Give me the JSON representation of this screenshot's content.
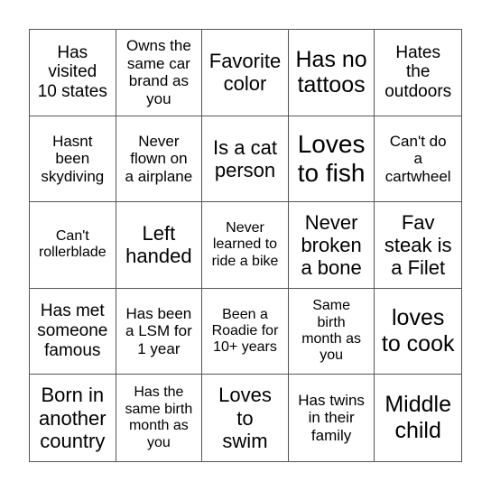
{
  "card": {
    "rows": [
      [
        {
          "text": "Has visited 10 states",
          "lines": [
            "Has",
            "visited",
            "10 states"
          ],
          "size": "m"
        },
        {
          "text": "Owns the same car brand as you",
          "lines": [
            "Owns the",
            "same car",
            "brand as",
            "you"
          ],
          "size": "s"
        },
        {
          "text": "Favorite color",
          "lines": [
            "Favorite",
            "color"
          ],
          "size": "l"
        },
        {
          "text": "Has no tattoos",
          "lines": [
            "Has no",
            "tattoos"
          ],
          "size": "xl"
        },
        {
          "text": "Hates the outdoors",
          "lines": [
            "Hates",
            "the",
            "outdoors"
          ],
          "size": "m"
        }
      ],
      [
        {
          "text": "Hasnt been skydiving",
          "lines": [
            "Hasnt",
            "been",
            "skydiving"
          ],
          "size": "s"
        },
        {
          "text": "Never flown on a airplane",
          "lines": [
            "Never",
            "flown on",
            "a airplane"
          ],
          "size": "s"
        },
        {
          "text": "Is a cat person",
          "lines": [
            "Is a cat",
            "person"
          ],
          "size": "l"
        },
        {
          "text": "Loves to fish",
          "lines": [
            "Loves",
            "to fish"
          ],
          "size": "xxl"
        },
        {
          "text": "Can't do a cartwheel",
          "lines": [
            "Can't do",
            "a",
            "cartwheel"
          ],
          "size": "s"
        }
      ],
      [
        {
          "text": "Can't rollerblade",
          "lines": [
            "Can't",
            "rollerblade"
          ],
          "size": "xs"
        },
        {
          "text": "Left handed",
          "lines": [
            "Left",
            "handed"
          ],
          "size": "l"
        },
        {
          "text": "Never learned to ride a bike",
          "lines": [
            "Never",
            "learned to",
            "ride a bike"
          ],
          "size": "xs"
        },
        {
          "text": "Never broken a bone",
          "lines": [
            "Never",
            "broken",
            "a bone"
          ],
          "size": "l"
        },
        {
          "text": "Fav steak is a Filet",
          "lines": [
            "Fav",
            "steak is",
            "a Filet"
          ],
          "size": "l"
        }
      ],
      [
        {
          "text": "Has met someone famous",
          "lines": [
            "Has met",
            "someone",
            "famous"
          ],
          "size": "m"
        },
        {
          "text": "Has been a LSM for 1 year",
          "lines": [
            "Has been",
            "a LSM for",
            "1 year"
          ],
          "size": "s"
        },
        {
          "text": "Been a Roadie for 10+ years",
          "lines": [
            "Been a",
            "Roadie for",
            "10+ years"
          ],
          "size": "xs"
        },
        {
          "text": "Same birth month as you",
          "lines": [
            "Same",
            "birth",
            "month as",
            "you"
          ],
          "size": "xs"
        },
        {
          "text": "loves to cook",
          "lines": [
            "loves",
            "to cook"
          ],
          "size": "xl"
        }
      ],
      [
        {
          "text": "Born in another country",
          "lines": [
            "Born in",
            "another",
            "country"
          ],
          "size": "l"
        },
        {
          "text": "Has the same birth month as you",
          "lines": [
            "Has the",
            "same birth",
            "month as",
            "you"
          ],
          "size": "xs"
        },
        {
          "text": "Loves to swim",
          "lines": [
            "Loves",
            "to",
            "swim"
          ],
          "size": "l"
        },
        {
          "text": "Has twins in their family",
          "lines": [
            "Has twins",
            "in their",
            "family"
          ],
          "size": "s"
        },
        {
          "text": "Middle child",
          "lines": [
            "Middle",
            "child"
          ],
          "size": "xl"
        }
      ]
    ]
  }
}
